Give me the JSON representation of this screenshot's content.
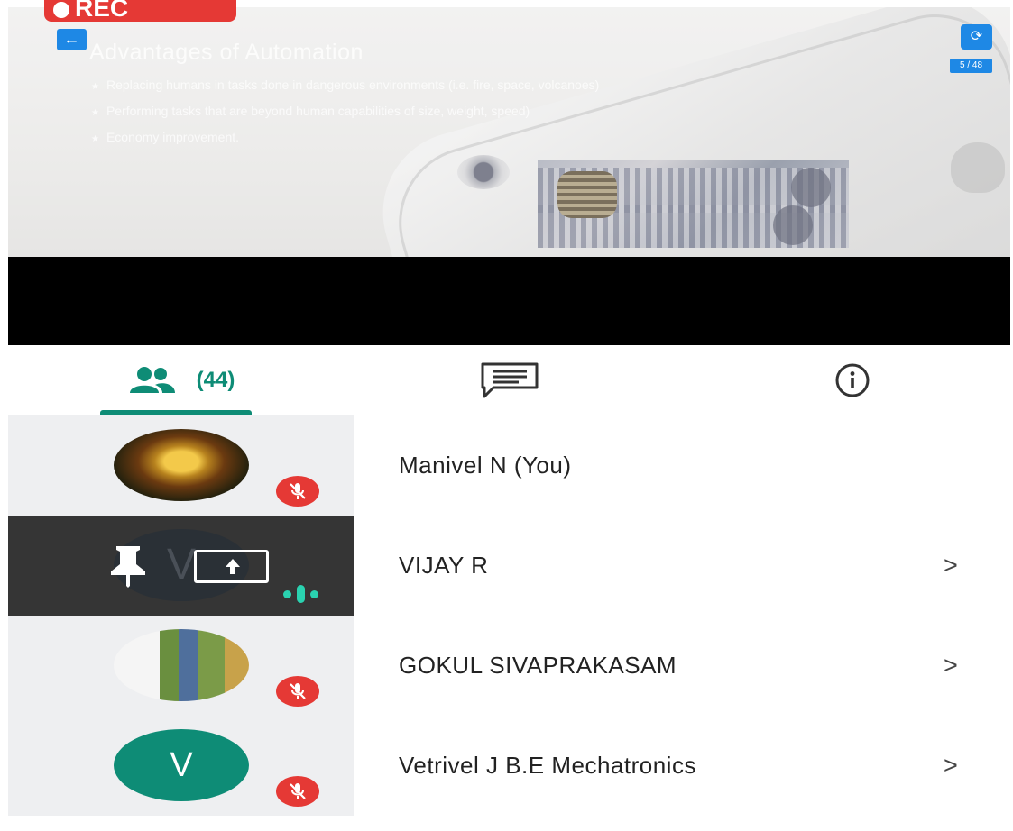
{
  "recording": {
    "label": "REC"
  },
  "slide": {
    "title": "Advantages of Automation",
    "bullets": [
      "Replacing humans in tasks done in dangerous environments (i.e. fire, space, volcanoes)",
      "Performing tasks that are beyond human capabilities of size, weight, speed)",
      "Economy improvement."
    ],
    "page_indicator": "5 / 48"
  },
  "tabs": {
    "participants_count": "(44)",
    "active": "participants"
  },
  "participants": [
    {
      "name": "Manivel N (You)",
      "avatar": "deity-photo",
      "muted": true,
      "has_chevron": false
    },
    {
      "name": "VIJAY R",
      "avatar": "V",
      "muted": false,
      "presenting": true,
      "speaking": true,
      "has_chevron": true,
      "chevron": ">"
    },
    {
      "name": "GOKUL SIVAPRAKASAM",
      "avatar": "person-photo",
      "muted": true,
      "has_chevron": true,
      "chevron": ">"
    },
    {
      "name": "Vetrivel J B.E Mechatronics",
      "avatar": "V",
      "muted": true,
      "has_chevron": true,
      "chevron": ">"
    }
  ],
  "colors": {
    "accent": "#0e8c76",
    "rec": "#e53935",
    "slide_buttons": "#1e88e5",
    "speaking": "#2ad2b0"
  },
  "icons": {
    "back": "arrow-left-icon",
    "rotate": "screen-rotate-icon",
    "participants": "people-icon",
    "chat": "chat-icon",
    "info": "info-icon",
    "muted": "mic-off-icon",
    "pin": "pin-icon",
    "share": "screen-share-icon"
  }
}
